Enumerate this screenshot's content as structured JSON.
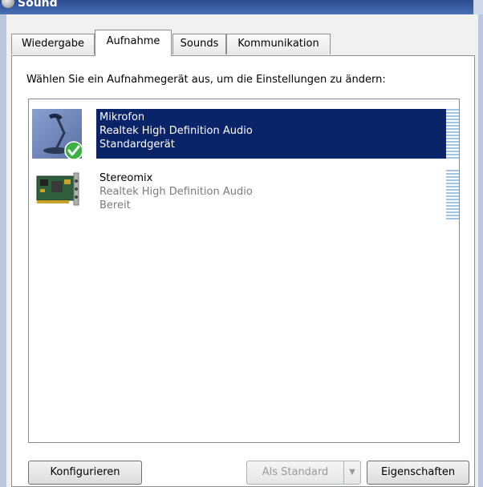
{
  "window": {
    "title": "Sound"
  },
  "tabs": [
    {
      "label": "Wiedergabe"
    },
    {
      "label": "Aufnahme"
    },
    {
      "label": "Sounds"
    },
    {
      "label": "Kommunikation"
    }
  ],
  "instruction": "Wählen Sie ein Aufnahmegerät aus, um die Einstellungen zu ändern:",
  "devices": [
    {
      "name": "Mikrofon",
      "driver": "Realtek High Definition Audio",
      "status": "Standardgerät",
      "icon": "microphone-icon",
      "selected": true
    },
    {
      "name": "Stereomix",
      "driver": "Realtek High Definition Audio",
      "status": "Bereit",
      "icon": "sound-card-icon",
      "selected": false
    }
  ],
  "buttons": {
    "configure": "Konfigurieren",
    "set_default": "Als Standard",
    "properties": "Eigenschaften"
  },
  "colors": {
    "selection": "#0a246a",
    "meter": "#9ec4e6",
    "default_check": "#3cb043"
  }
}
